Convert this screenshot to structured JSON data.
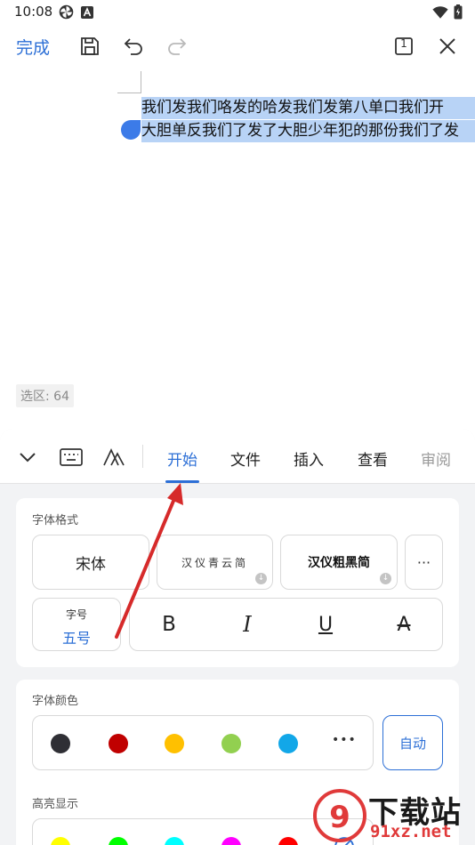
{
  "status_bar": {
    "time": "10:08"
  },
  "toolbar": {
    "done_label": "完成",
    "page_indicator": "1"
  },
  "document": {
    "selected_lines": [
      "我们发我们咯发的哈发我们发第八单口我们开",
      "大胆单反我们了发了大胆少年犯的那份我们了发"
    ],
    "selection_count": "选区: 64"
  },
  "ribbon": {
    "tabs": [
      "开始",
      "文件",
      "插入",
      "查看",
      "审阅"
    ],
    "active_tab": "开始"
  },
  "font_format": {
    "title": "字体格式",
    "fonts": [
      "宋体",
      "汉仪青云简",
      "汉仪粗黑简"
    ],
    "more_label": "···",
    "size_label": "字号",
    "size_value": "五号",
    "styles": [
      "B",
      "I",
      "U",
      "A"
    ]
  },
  "font_color": {
    "title": "字体颜色",
    "swatches": [
      "#2f2f35",
      "#c00000",
      "#ffc000",
      "#92d050",
      "#12a7e8"
    ],
    "more_label": "•••",
    "auto_label": "自动"
  },
  "highlight": {
    "title": "高亮显示",
    "swatches": [
      "#ffff00",
      "#00ff00",
      "#00ffff",
      "#ff00ff",
      "#ff0000"
    ]
  },
  "watermark": {
    "line1": "下载站",
    "line2": "91xz.net"
  },
  "colors": {
    "accent": "#2c6fd6",
    "selection": "#b8d3f6",
    "annotation_arrow": "#d62a2a"
  }
}
